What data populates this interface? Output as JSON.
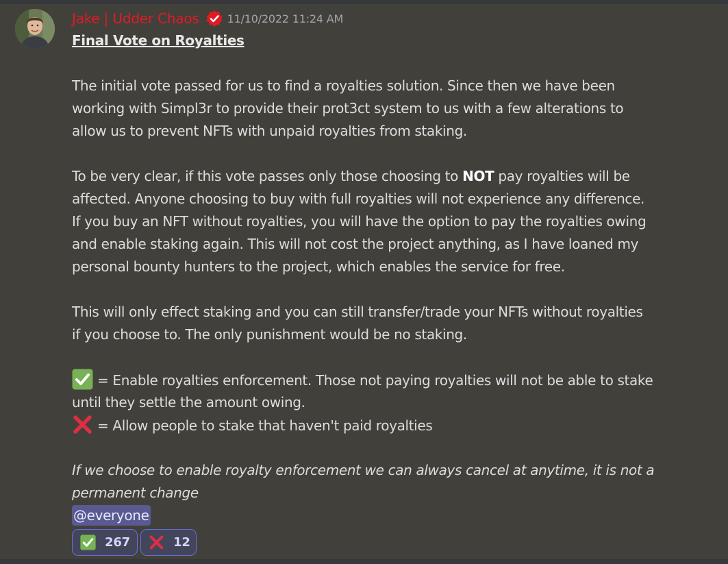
{
  "message": {
    "author": "Jake | Udder Chaos",
    "timestamp": "11/10/2022 11:24 AM",
    "title": "Final Vote on Royalties",
    "paragraph1": [
      "The initial vote passed for us to find a royalties solution. Since then we have been",
      "working with Simpl3r to provide their prot3ct system to us with a few alterations to",
      "allow us to prevent NFTs with unpaid royalties from staking."
    ],
    "paragraph2": {
      "line1_before": "To be very clear, if this vote passes only those choosing to ",
      "line1_bold": "NOT",
      "line1_after": " pay royalties will be",
      "lines": [
        "affected. Anyone choosing to buy with full royalties will not experience any difference.",
        "If you buy an NFT without royalties, you will have the option to pay the royalties owing",
        "and enable staking again. This will not cost the project anything, as I have loaned my",
        "personal bounty hunters to the project, which enables the service for free."
      ]
    },
    "paragraph3": [
      "This will only effect staking and you can still transfer/trade your NFTs without royalties",
      "if you choose to. The only punishment would be no staking."
    ],
    "option_yes": {
      "icon": "white-check-mark-emoji",
      "line1": "= Enable royalties enforcement. Those not paying royalties will not be able to stake",
      "line2": "until they settle the amount owing."
    },
    "option_no": {
      "icon": "cross-mark-emoji",
      "text": "= Allow people to stake that haven't paid royalties"
    },
    "note": [
      "If we choose to enable royalty enforcement we can always cancel at anytime, it is not a",
      "permanent change"
    ],
    "mention": "@everyone"
  },
  "reactions": [
    {
      "icon": "white-check-mark-emoji",
      "count": "267"
    },
    {
      "icon": "cross-mark-emoji",
      "count": "12"
    }
  ],
  "colors": {
    "background": "#42403b",
    "author": "#e01b24",
    "mention_bg": "#5a5a92",
    "reaction_border": "#6a6ce0",
    "check_green": "#77b255",
    "cross_red": "#dd2e44"
  }
}
